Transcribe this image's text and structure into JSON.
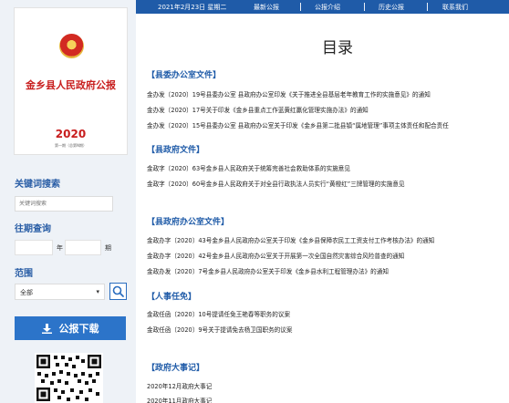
{
  "nav": {
    "date": "2021年2月23日 星期二",
    "links": [
      "最新公报",
      "公报介绍",
      "历史公报",
      "联系我们"
    ]
  },
  "cover": {
    "title": "金乡县人民政府公报",
    "year": "2020",
    "issue": "第一期（总第N期）"
  },
  "sidebar": {
    "keyword_heading": "关键词搜索",
    "keyword_placeholder": "关键词搜索",
    "date_heading": "往期查询",
    "year_label": "年",
    "month_label": "期",
    "range_heading": "范围",
    "range_value": "全部",
    "download_label": "公报下载"
  },
  "main": {
    "title": "目录",
    "sections": [
      {
        "heading": "【县委办公室文件】",
        "items": [
          "金办发〔2020〕19号县委办公室 县政府办公室印发《关于推进全县基层老年教育工作的实施意见》的通知",
          "金办发〔2020〕17号关于印发《金乡县重点工作蓝黄红赢化管理实施办法》的通知",
          "金办发〔2020〕15号县委办公室 县政府办公室关于印发《金乡县第二批县镇“属地管理”事项主体责任和配合责任"
        ]
      },
      {
        "heading": "【县政府文件】",
        "items": [
          "金政字〔2020〕63号金乡县人民政府关于统筹完善社会救助体系的实施意见",
          "金政字〔2020〕60号金乡县人民政府关于对全县行政执法人员实行“黄橙红”三牌管理的实施意见"
        ]
      },
      {
        "heading": "【县政府办公室文件】",
        "items": [
          "金政办字〔2020〕43号金乡县人民政府办公室关于印发《金乡县保障农民工工资支付工作考核办法》的通知",
          "金政办字〔2020〕42号金乡县人民政府办公室关于开展第一次全国自然灾害综合风险普查的通知",
          "金政办发〔2020〕7号金乡县人民政府办公室关于印发《金乡县水利工程管理办法》的通知"
        ]
      },
      {
        "heading": "【人事任免】",
        "items": [
          "金政任函〔2020〕10号提请任免王艳春等职务的议案",
          "金政任函〔2020〕9号关于提请免去杨卫国职务的议案"
        ]
      },
      {
        "heading": "【政府大事记】",
        "items": [
          "2020年12月政府大事记",
          "2020年11月政府大事记"
        ]
      }
    ]
  },
  "icons": {
    "search": "search-icon",
    "download": "download-icon",
    "emblem": "national-emblem-icon",
    "qr": "qr-code-icon"
  },
  "colors": {
    "nav_bg": "#1f5ba8",
    "accent": "#2c74c9",
    "sidebar_bg": "#eef2f7",
    "cover_red": "#c81e1e"
  }
}
